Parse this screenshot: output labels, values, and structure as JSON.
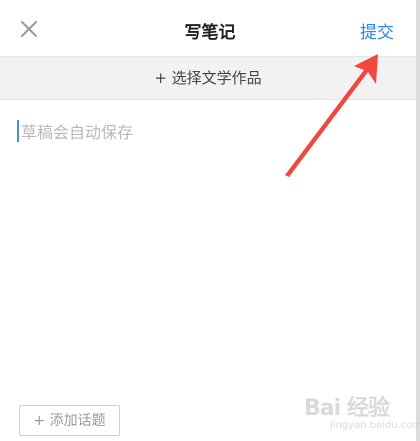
{
  "header": {
    "close_icon": "close-icon",
    "title": "写笔记",
    "submit_label": "提交"
  },
  "select_bar": {
    "label": "+ 选择文学作品"
  },
  "editor": {
    "placeholder": "草稿会自动保存",
    "value": ""
  },
  "topic_button": {
    "label": "+ 添加话题"
  },
  "annotation": {
    "arrow_color": "#f0473e"
  },
  "watermark": {
    "main": "Bai 经验",
    "sub": "jingyan.baidu.com"
  },
  "colors": {
    "accent": "#2a86e8",
    "arrow": "#f0473e"
  }
}
